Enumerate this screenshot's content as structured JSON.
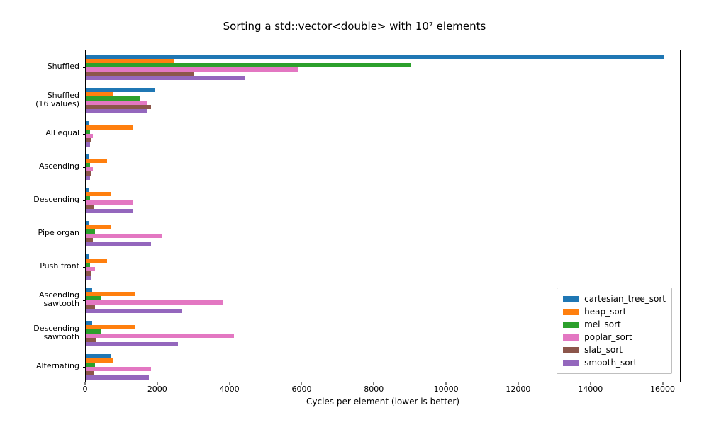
{
  "chart_data": {
    "type": "bar",
    "title": "Sorting a std::vector<double> with 10⁷ elements",
    "xlabel": "Cycles per element (lower is better)",
    "ylabel": "",
    "xlim": [
      0,
      16500
    ],
    "xticks": [
      0,
      2000,
      4000,
      6000,
      8000,
      10000,
      12000,
      14000,
      16000
    ],
    "categories": [
      "Shuffled",
      "Shuffled\n(16 values)",
      "All equal",
      "Ascending",
      "Descending",
      "Pipe organ",
      "Push front",
      "Ascending\nsawtooth",
      "Descending\nsawtooth",
      "Alternating"
    ],
    "series": [
      {
        "name": "cartesian_tree_sort",
        "color": "#1f77b4",
        "values": [
          16000,
          1900,
          100,
          90,
          100,
          90,
          100,
          170,
          170,
          700
        ]
      },
      {
        "name": "heap_sort",
        "color": "#ff7f0e",
        "values": [
          2450,
          750,
          1300,
          580,
          700,
          700,
          580,
          1350,
          1350,
          750
        ]
      },
      {
        "name": "mel_sort",
        "color": "#2ca02c",
        "values": [
          9000,
          1500,
          110,
          110,
          120,
          250,
          120,
          430,
          430,
          250
        ]
      },
      {
        "name": "poplar_sort",
        "color": "#e377c2",
        "values": [
          5900,
          1700,
          200,
          200,
          1300,
          2100,
          250,
          3800,
          4100,
          1800
        ]
      },
      {
        "name": "slab_sort",
        "color": "#8c564b",
        "values": [
          3000,
          1800,
          160,
          160,
          220,
          200,
          160,
          260,
          300,
          220
        ]
      },
      {
        "name": "smooth_sort",
        "color": "#9467bd",
        "values": [
          4400,
          1700,
          120,
          120,
          1300,
          1800,
          130,
          2650,
          2550,
          1750
        ]
      }
    ]
  },
  "legend": {
    "items": [
      {
        "label": "cartesian_tree_sort",
        "color": "#1f77b4"
      },
      {
        "label": "heap_sort",
        "color": "#ff7f0e"
      },
      {
        "label": "mel_sort",
        "color": "#2ca02c"
      },
      {
        "label": "poplar_sort",
        "color": "#e377c2"
      },
      {
        "label": "slab_sort",
        "color": "#8c564b"
      },
      {
        "label": "smooth_sort",
        "color": "#9467bd"
      }
    ]
  }
}
